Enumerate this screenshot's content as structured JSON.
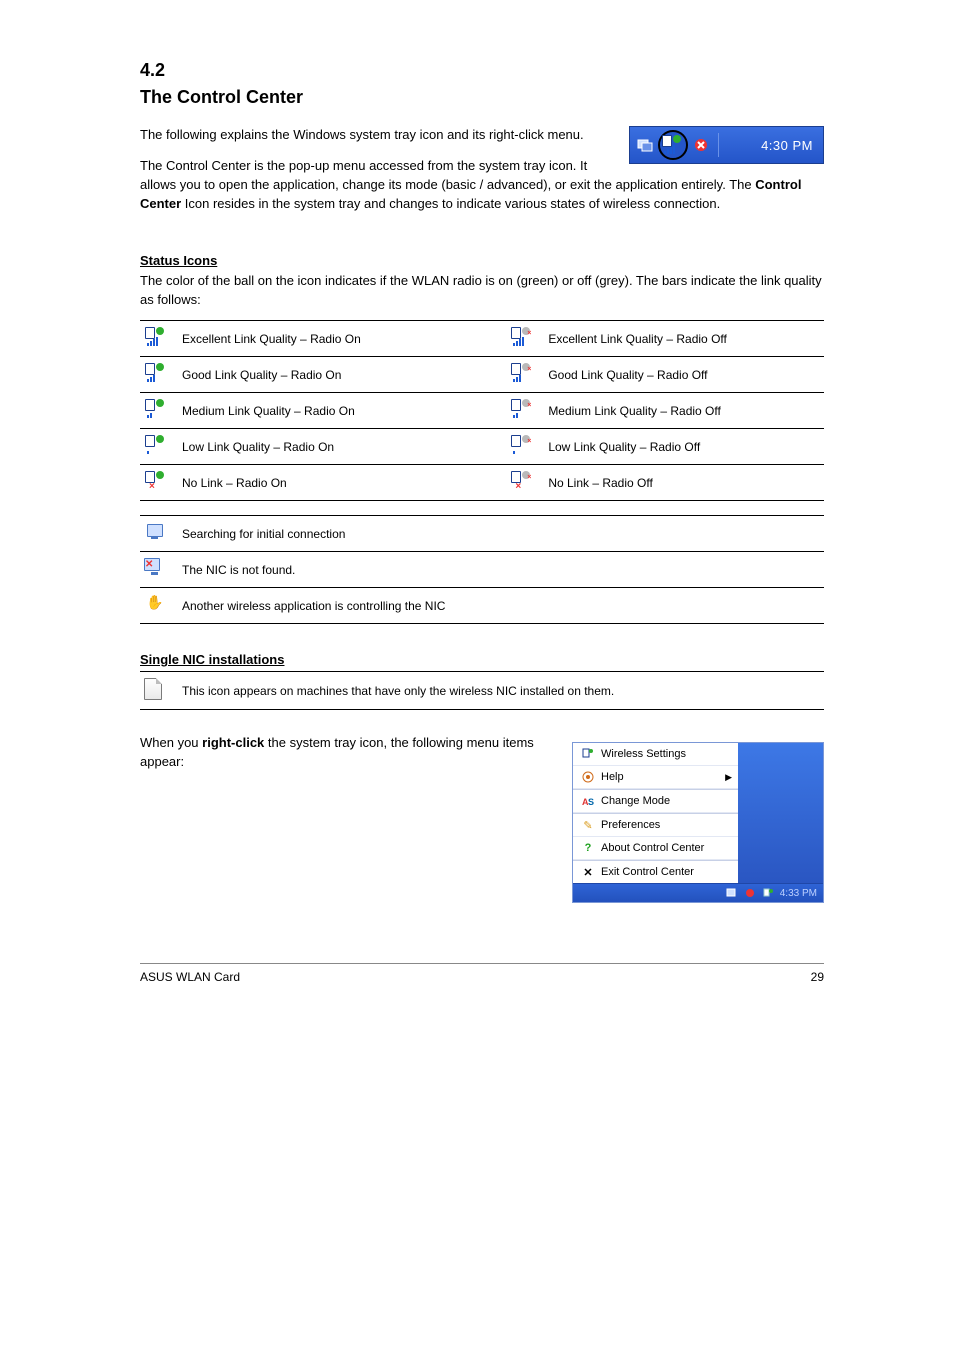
{
  "section": {
    "number": "4.2",
    "title": "The Control Center"
  },
  "intro": {
    "p1": "The following explains the Windows system tray icon and its right-click menu.",
    "p2_a": "The Control Center is the pop-up menu accessed from the system tray icon. It allows you to open the application, change its mode (basic / advanced), or exit the application entirely. The ",
    "p2_b": "Control Center",
    "p2_c": " Icon resides in the system tray and changes to indicate various states of wireless connection."
  },
  "tray_time": "4:30 PM",
  "status_icons": {
    "heading": "Status Icons",
    "desc": "The color of the ball on the icon indicates if the WLAN radio is on (green) or off (grey). The bars indicate the link quality as follows:",
    "rows": [
      {
        "on": "Excellent Link Quality – Radio On",
        "off": "Excellent Link Quality – Radio Off"
      },
      {
        "on": "Good Link Quality – Radio On",
        "off": "Good Link Quality – Radio Off"
      },
      {
        "on": "Medium Link Quality – Radio On",
        "off": "Medium Link Quality – Radio Off"
      },
      {
        "on": "Low Link Quality – Radio On",
        "off": "Low Link Quality – Radio Off"
      },
      {
        "on": "No Link – Radio On",
        "off": "No Link – Radio Off"
      }
    ],
    "extra": [
      "Searching for initial connection",
      "The NIC is not found.",
      "Another wireless application is controlling the NIC"
    ]
  },
  "single_nic": {
    "heading": "Single NIC installations",
    "row": "This icon appears on machines that have only the wireless NIC installed on them."
  },
  "rc_menu": {
    "intro_a": "When you ",
    "intro_b": "right-click",
    "intro_c": " the system tray icon, the following menu items appear:",
    "items": [
      "Wireless Settings",
      "Help",
      "Change Mode",
      "Preferences",
      "About Control Center",
      "Exit Control Center"
    ],
    "bottom_time": "4:33 PM"
  },
  "footer": {
    "left": "ASUS WLAN Card",
    "right": "29"
  }
}
